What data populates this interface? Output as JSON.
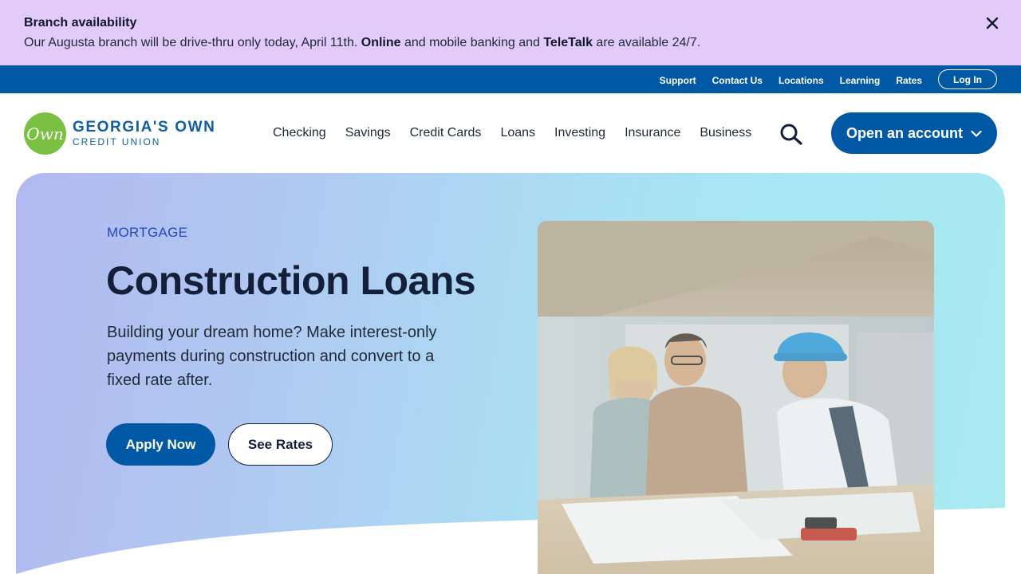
{
  "alert": {
    "title": "Branch availability",
    "msg_part1": "Our Augusta branch will be drive-thru only today, April 11th. ",
    "msg_bold1": "Online",
    "msg_part2": " and mobile banking and ",
    "msg_bold2": "TeleTalk",
    "msg_part3": " are available 24/7.",
    "close_icon": "close-icon"
  },
  "utility": {
    "links": [
      "Support",
      "Contact Us",
      "Locations",
      "Learning",
      "Rates"
    ],
    "login_label": "Log In"
  },
  "logo": {
    "mark_text": "Own",
    "line1": "GEORGIA'S OWN",
    "line2": "CREDIT UNION"
  },
  "nav": {
    "items": [
      "Checking",
      "Savings",
      "Credit Cards",
      "Loans",
      "Investing",
      "Insurance",
      "Business"
    ],
    "search_icon": "search-icon",
    "open_account_label": "Open an account",
    "open_account_icon": "chevron-down-icon"
  },
  "hero": {
    "eyebrow": "MORTGAGE",
    "title": "Construction Loans",
    "description": "Building your dream home? Make interest-only payments during construction and convert to a fixed rate after.",
    "apply_label": "Apply Now",
    "rates_label": "See Rates"
  },
  "colors": {
    "alert_bg": "#e2cbfb",
    "primary_blue": "#0159a6",
    "logo_green": "#7ac143",
    "hero_text": "#14203a"
  }
}
